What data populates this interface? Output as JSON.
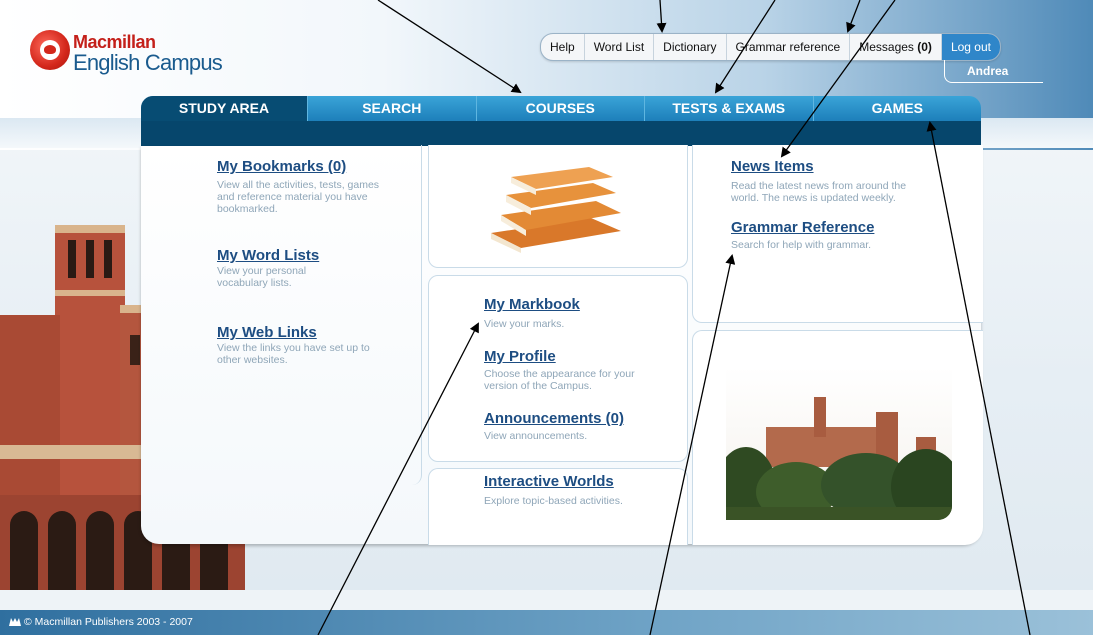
{
  "logo": {
    "line1": "Macmillan",
    "line2": "English Campus"
  },
  "toplinks": {
    "help": "Help",
    "word_list": "Word List",
    "dictionary": "Dictionary",
    "grammar_reference": "Grammar reference",
    "messages_label": "Messages",
    "messages_count": "(0)",
    "logout": "Log out"
  },
  "user": {
    "name": "Andrea"
  },
  "nav": {
    "tabs": [
      {
        "label": "STUDY AREA"
      },
      {
        "label": "SEARCH"
      },
      {
        "label": "COURSES"
      },
      {
        "label": "TESTS & EXAMS"
      },
      {
        "label": "GAMES"
      }
    ],
    "active": "STUDY AREA"
  },
  "study": {
    "bookmarks": {
      "title": "My Bookmarks (0)",
      "desc": "View all the activities, tests, games and reference material you have bookmarked."
    },
    "word_lists": {
      "title": "My Word Lists",
      "desc": "View your personal vocabulary lists."
    },
    "web_links": {
      "title": "My Web Links",
      "desc": "View the links you have set up to other websites."
    },
    "markbook": {
      "title": "My Markbook",
      "desc": "View your marks."
    },
    "profile": {
      "title": "My Profile",
      "desc": "Choose the appearance for your version of the Campus."
    },
    "announcements": {
      "title": "Announcements (0)",
      "desc": "View announcements."
    },
    "interactive_worlds": {
      "title": "Interactive Worlds",
      "desc": "Explore topic-based activities."
    },
    "news_items": {
      "title": "News Items",
      "desc": "Read the latest news from around the world. The news is updated weekly."
    },
    "grammar_reference": {
      "title": "Grammar Reference",
      "desc": "Search for help with grammar."
    }
  },
  "footer": {
    "copyright": "© Macmillan Publishers 2003 - 2007"
  },
  "colors": {
    "nav_active": "#074c73",
    "nav": "#1d7fba",
    "link": "#1d4d82",
    "logout": "#2f86c9"
  }
}
